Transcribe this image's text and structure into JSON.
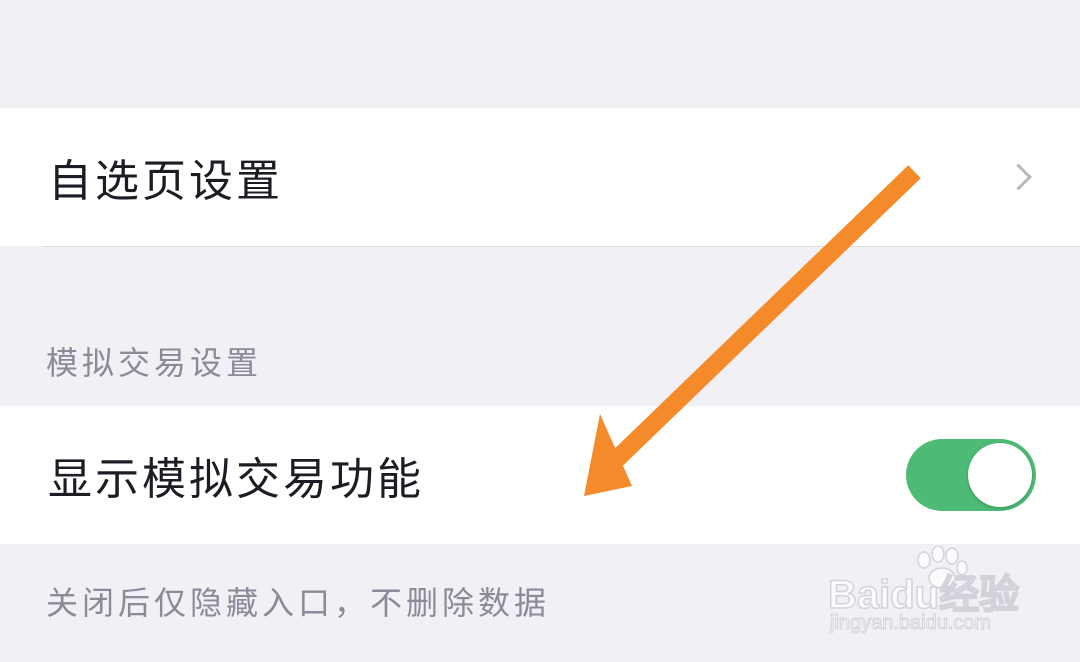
{
  "settings": {
    "watchlist_row": {
      "label": "自选页设置"
    },
    "sim_section": {
      "header": "模拟交易设置",
      "toggle_row": {
        "label": "显示模拟交易功能",
        "enabled": true
      },
      "footnote": "关闭后仅隐藏入口，不删除数据"
    }
  },
  "icons": {
    "row_chevron": "chevron-right-icon",
    "annotation": "arrow-annotation"
  },
  "colors": {
    "background": "#f0f0f5",
    "row_background": "#ffffff",
    "toggle_on": "#4dbb76",
    "annotation_arrow": "#f58a2a",
    "secondary_text": "#8a8a98"
  },
  "watermark": {
    "logo": "Baidu经验",
    "url": "jingyan.baidu.com"
  }
}
